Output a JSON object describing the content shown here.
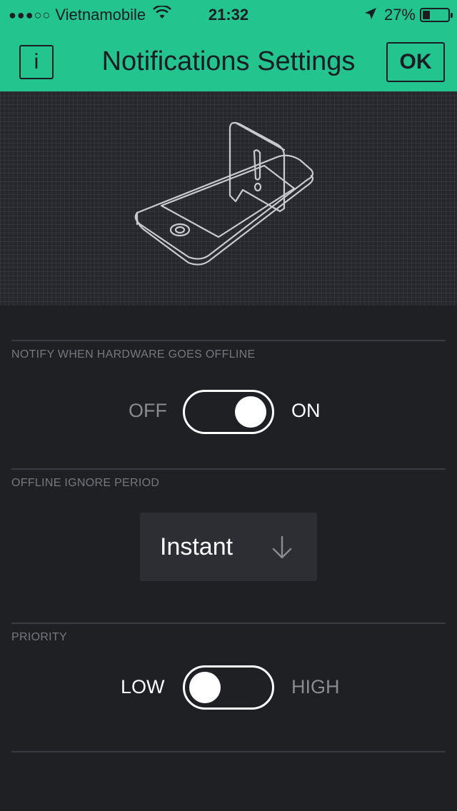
{
  "status_bar": {
    "signal": "●●●○○",
    "carrier": "Vietnamobile",
    "time": "21:32",
    "battery": "27%",
    "battery_level": 0.27
  },
  "header": {
    "info_label": "i",
    "title": "Notifications Settings",
    "ok_label": "OK",
    "background_color": "#23c48e"
  },
  "illustration": {
    "icon": "phone-notification-icon"
  },
  "sections": {
    "offline_notify": {
      "label": "NOTIFY WHEN HARDWARE GOES OFFLINE",
      "off_label": "OFF",
      "on_label": "ON",
      "state": "on"
    },
    "ignore_period": {
      "label": "OFFLINE IGNORE PERIOD",
      "value": "Instant",
      "icon": "arrow-down-icon"
    },
    "priority": {
      "label": "PRIORITY",
      "low_label": "LOW",
      "high_label": "HIGH",
      "state": "low"
    }
  },
  "colors": {
    "accent": "#23c48e",
    "background": "#1f2024",
    "active_text": "#ffffff",
    "inactive_text": "#8a8b90"
  }
}
